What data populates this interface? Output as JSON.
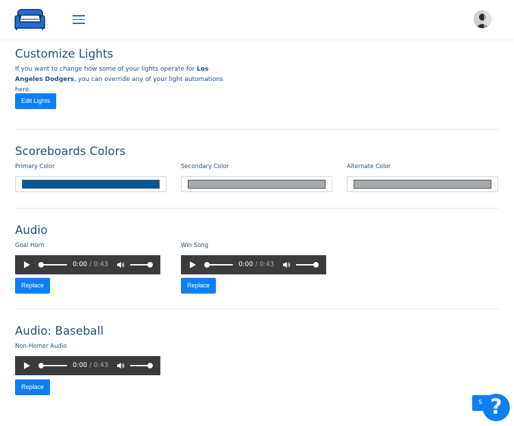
{
  "header": {
    "logo_icon": "couch-icon",
    "menu_icon": "hamburger-menu-icon",
    "avatar_icon": "user-avatar"
  },
  "customize": {
    "title": "Customize Lights",
    "desc_pre": "If you want to change how some of your lights operate for ",
    "team": "Los Angeles Dodgers",
    "desc_post": ", you can override any of your light automations here.",
    "button": "Edit Lights"
  },
  "scoreboard": {
    "title": "Scoreboards Colors",
    "primary_label": "Primary Color",
    "secondary_label": "Secondary Color",
    "alternate_label": "Alternate Color",
    "primary_color": "#005a9c",
    "secondary_color": "#a5a9ab",
    "alternate_color": "#a5a9ab"
  },
  "audio": {
    "title": "Audio",
    "goal_horn_label": "Goal Horn",
    "win_song_label": "Win Song",
    "replace_label": "Replace",
    "current_time": "0:00",
    "duration": "/ 0:43"
  },
  "baseball": {
    "title": "Audio: Baseball",
    "non_homer_label": "Non-Homer Audio",
    "replace_label": "Replace",
    "current_time": "0:00",
    "duration": "/ 0:43"
  },
  "floating": {
    "save_partial": "S",
    "help_glyph": "?"
  }
}
